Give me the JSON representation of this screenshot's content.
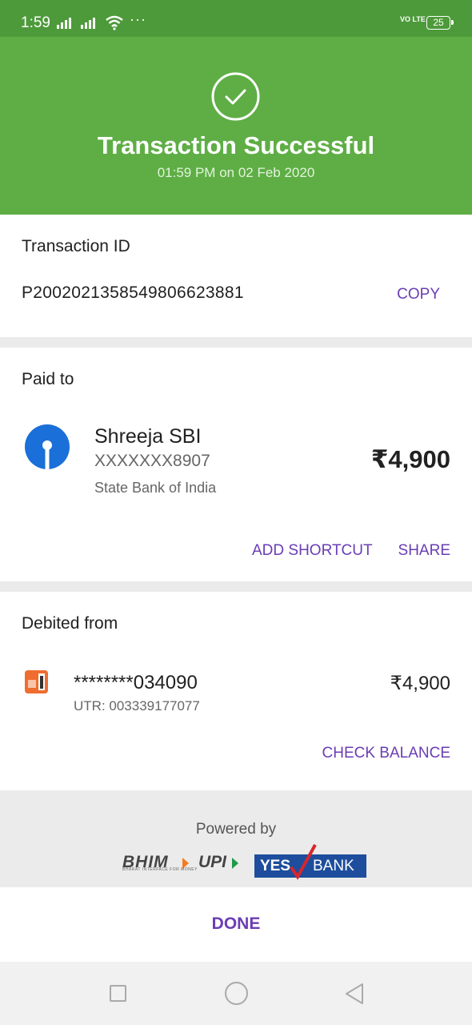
{
  "status_bar": {
    "time": "1:59",
    "dots": "···",
    "volte": "VO LTE",
    "battery": "25"
  },
  "header": {
    "title": "Transaction Successful",
    "timestamp": "01:59 PM on 02 Feb 2020",
    "accent_color": "#5eae45"
  },
  "transaction": {
    "label": "Transaction ID",
    "id": "P2002021358549806623881",
    "copy_label": "COPY"
  },
  "paid_to": {
    "label": "Paid to",
    "name": "Shreeja SBI",
    "account": "XXXXXXX8907",
    "bank": "State Bank of India",
    "amount": "₹4,900",
    "add_shortcut_label": "ADD SHORTCUT",
    "share_label": "SHARE"
  },
  "debited_from": {
    "label": "Debited from",
    "account": "********034090",
    "utr": "UTR: 003339177077",
    "amount": "₹4,900",
    "check_balance_label": "CHECK BALANCE"
  },
  "powered_by": {
    "label": "Powered by",
    "bhim": "BHIM",
    "bhim_tagline": "BHARAT INTERFACE FOR MONEY",
    "upi": "UPI",
    "yes": "YES",
    "bank": "BANK"
  },
  "done_label": "DONE",
  "icons": [
    "check-circle-icon",
    "sbi-logo-icon",
    "bank-logo-icon",
    "nav-recents-icon",
    "nav-home-icon",
    "nav-back-icon"
  ],
  "colors": {
    "purple": "#6a3db4",
    "green": "#5eae45",
    "sbi_blue": "#1a6fd8",
    "yes_blue": "#1d4d9c"
  }
}
